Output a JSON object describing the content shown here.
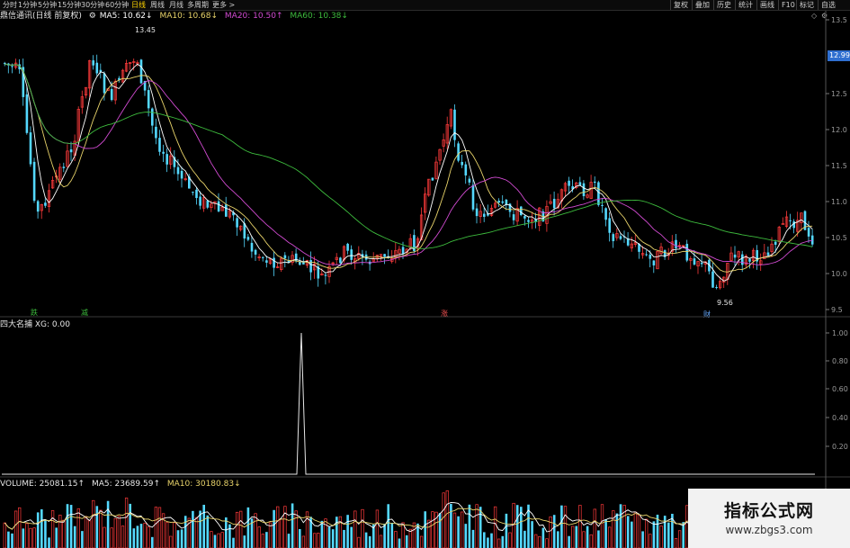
{
  "toolbar": {
    "periods": [
      "分时",
      "1分钟",
      "5分钟",
      "15分钟",
      "30分钟",
      "60分钟",
      "日线",
      "周线",
      "月线",
      "多周期",
      "更多 >"
    ],
    "active_period": "日线",
    "right_buttons": [
      "复权",
      "叠加",
      "历史",
      "统计",
      "画线",
      "F10",
      "标记",
      "自选"
    ]
  },
  "main": {
    "title": "鼎信通讯(日线 前复权)",
    "ma5": "MA5: 10.62↓",
    "ma10": "MA10: 10.68↓",
    "ma20": "MA20: 10.50↑",
    "ma60": "MA60: 10.38↓",
    "high_label": "13.45",
    "low_label": "9.56",
    "current_price": "12.99",
    "yaxis": [
      "13.5",
      "13.0",
      "12.5",
      "12.0",
      "11.5",
      "11.0",
      "10.5",
      "10.0",
      "9.5"
    ],
    "markers": [
      "跌",
      "减",
      "涨",
      "财"
    ]
  },
  "indicator": {
    "title": "四大名捕 XG: 0.00",
    "yaxis": [
      "1.00",
      "0.80",
      "0.60",
      "0.40",
      "0.20"
    ]
  },
  "volume": {
    "label": "VOLUME: 25081.15↑",
    "ma5": "MA5: 23689.59↑",
    "ma10": "MA10: 30180.83↓"
  },
  "watermark": {
    "title": "指标公式网",
    "url": "www.zbgs3.com"
  },
  "colors": {
    "up": "#ff3b3b",
    "down": "#54d8ff",
    "ma5": "#ffffff",
    "ma10": "#e8d36a",
    "ma20": "#d24bd2",
    "ma60": "#3dbb3d"
  }
}
